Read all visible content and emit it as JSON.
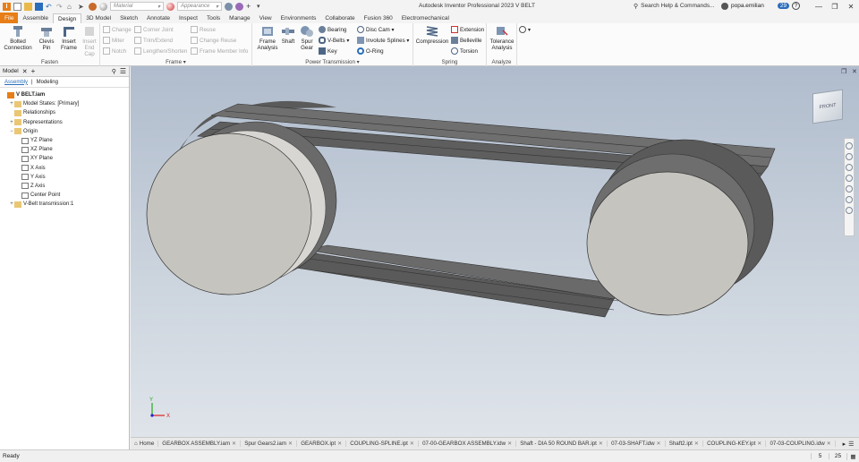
{
  "app": {
    "title": "Autodesk Inventor Professional 2023   V BELT",
    "material_placeholder": "Material",
    "appearance_placeholder": "Appearance",
    "search_label": "Search Help & Commands...",
    "user": "popa.emilian",
    "notif_count": "29"
  },
  "tabs": [
    "File",
    "Assemble",
    "Design",
    "3D Model",
    "Sketch",
    "Annotate",
    "Inspect",
    "Tools",
    "Manage",
    "View",
    "Environments",
    "Collaborate",
    "Fusion 360",
    "Electromechanical"
  ],
  "active_tab": "Design",
  "ribbon": {
    "fasten": {
      "label": "Fasten",
      "bolted": "Bolted Connection",
      "clevis": "Clevis Pin",
      "insert_frame": "Insert Frame",
      "insert_end_cap": "Insert End Cap"
    },
    "frame": {
      "label": "Frame ▾",
      "items": [
        "Change",
        "Miter",
        "Notch",
        "Corner Joint",
        "Trim/Extend",
        "Lengthen/Shorten",
        "Reuse",
        "Change Reuse",
        "Frame Member Info"
      ]
    },
    "power": {
      "label": "Power Transmission ▾",
      "frame_analysis": "Frame Analysis",
      "shaft": "Shaft",
      "spur_gear": "Spur Gear",
      "items": [
        "Bearing",
        "V-Belts ▾",
        "Key",
        "Disc Cam ▾",
        "Involute Splines ▾",
        "O-Ring"
      ]
    },
    "spring": {
      "label": "Spring",
      "compression": "Compression",
      "items": [
        "Extension",
        "Belleville",
        "Torsion"
      ]
    },
    "analyze": {
      "label": "Analyze",
      "tolerance": "Tolerance Analysis"
    }
  },
  "browser": {
    "title": "Model",
    "tab_assembly": "Assembly",
    "tab_modeling": "Modeling",
    "tree": [
      {
        "label": "V BELT.iam",
        "level": 0,
        "bold": true
      },
      {
        "label": "Model States: [Primary]",
        "level": 1,
        "exp": "+"
      },
      {
        "label": "Relationships",
        "level": 1
      },
      {
        "label": "Representations",
        "level": 1,
        "exp": "+"
      },
      {
        "label": "Origin",
        "level": 1,
        "exp": "−"
      },
      {
        "label": "YZ Plane",
        "level": 2
      },
      {
        "label": "XZ Plane",
        "level": 2
      },
      {
        "label": "XY Plane",
        "level": 2
      },
      {
        "label": "X Axis",
        "level": 2
      },
      {
        "label": "Y Axis",
        "level": 2
      },
      {
        "label": "Z Axis",
        "level": 2
      },
      {
        "label": "Center Point",
        "level": 2
      },
      {
        "label": "V-Belt transmission:1",
        "level": 1,
        "exp": "+"
      }
    ]
  },
  "viewcube": {
    "face": "FRONT"
  },
  "triad": {
    "x": "X",
    "y": "Y"
  },
  "doc_tabs": [
    "Home",
    "GEARBOX ASSEMBLY.iam",
    "Spur Gears2.iam",
    "GEARBOX.ipt",
    "COUPLING-SPLINE.ipt",
    "07-00-GEARBOX ASSEMBLY.idw",
    "Shaft - DIA 50 ROUND BAR.ipt",
    "07-03-SHAFT.idw",
    "Shaft2.ipt",
    "COUPLING-KEY.ipt",
    "07-03-COUPLING.idw",
    "07-09-SHAFT"
  ],
  "status": {
    "text": "Ready",
    "v1": "5",
    "v2": "25"
  },
  "colors": {
    "accent": "#e77e17",
    "tab_blue": "#2a6ebb"
  }
}
